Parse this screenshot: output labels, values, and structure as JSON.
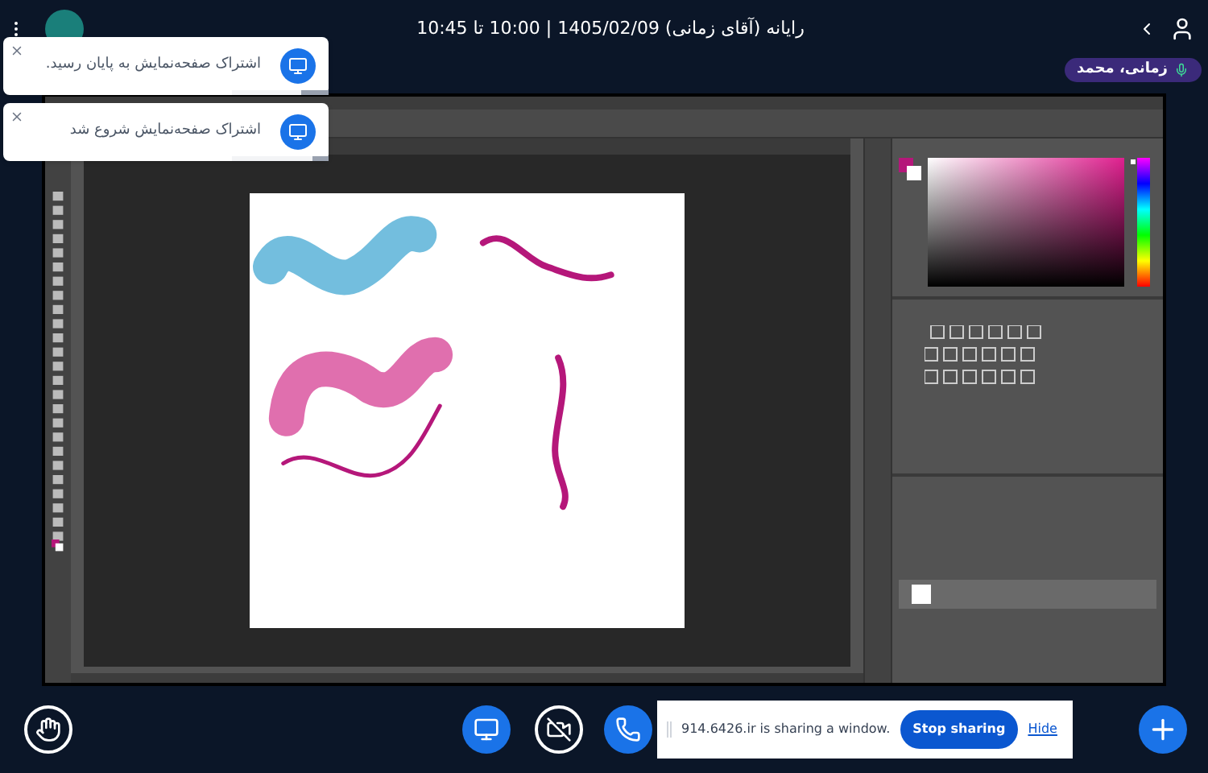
{
  "header": {
    "title": "رایانه (آقای زمانی) 1405/02/09 | 10:00 تا 10:45"
  },
  "presenter": {
    "name": "زمانی، محمد"
  },
  "toasts": [
    {
      "text": "اشتراک صفحه‌نمایش به پایان رسید.",
      "level": 0.28
    },
    {
      "text": "اشتراک صفحه‌نمایش شروع شد",
      "level": 0.17
    }
  ],
  "shared_window": {
    "hue_slider": {
      "level": 0.95
    }
  },
  "sharing_bar": {
    "message": "914.6426.ir is sharing a window.",
    "stop_button": "Stop sharing",
    "hide_link": "Hide"
  }
}
